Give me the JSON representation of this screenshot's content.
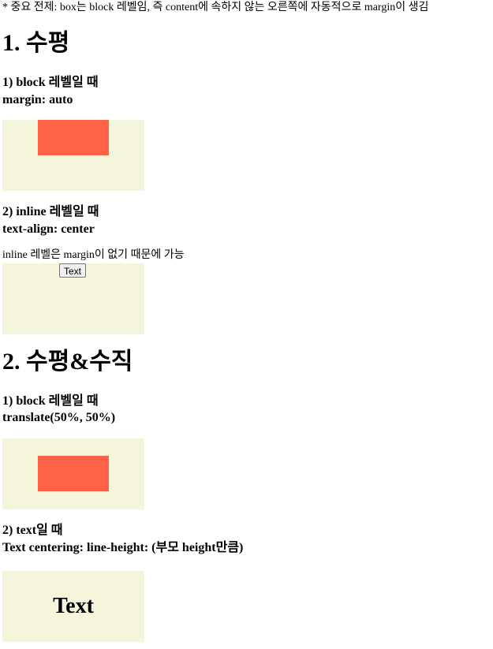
{
  "top_note": "* 중요 전제: box는 block 레벨임, 즉 content에 속하지 않는 오른쪽에 자동적으로 margin이 생김",
  "section1": {
    "title": "1. 수평",
    "block": {
      "line1": "1) block 레벨일 때",
      "line2": "margin: auto"
    },
    "inline": {
      "line1": "2) inline 레벨일 때",
      "line2": "text-align: center",
      "note": "inline 레벨은 margin이 없기 때문에 가능",
      "button_label": "Text"
    }
  },
  "section2": {
    "title": "2. 수평&수직",
    "block": {
      "line1": "1) block 레벨일 때",
      "line2": "translate(50%, 50%)"
    },
    "text": {
      "line1": "2) text일 때",
      "line2": "Text centering: line-height: (부모 height만큼)",
      "demo_text": "Text"
    }
  },
  "colors": {
    "box_bg": "#f5f5dc",
    "inner_box": "#ff6347"
  }
}
